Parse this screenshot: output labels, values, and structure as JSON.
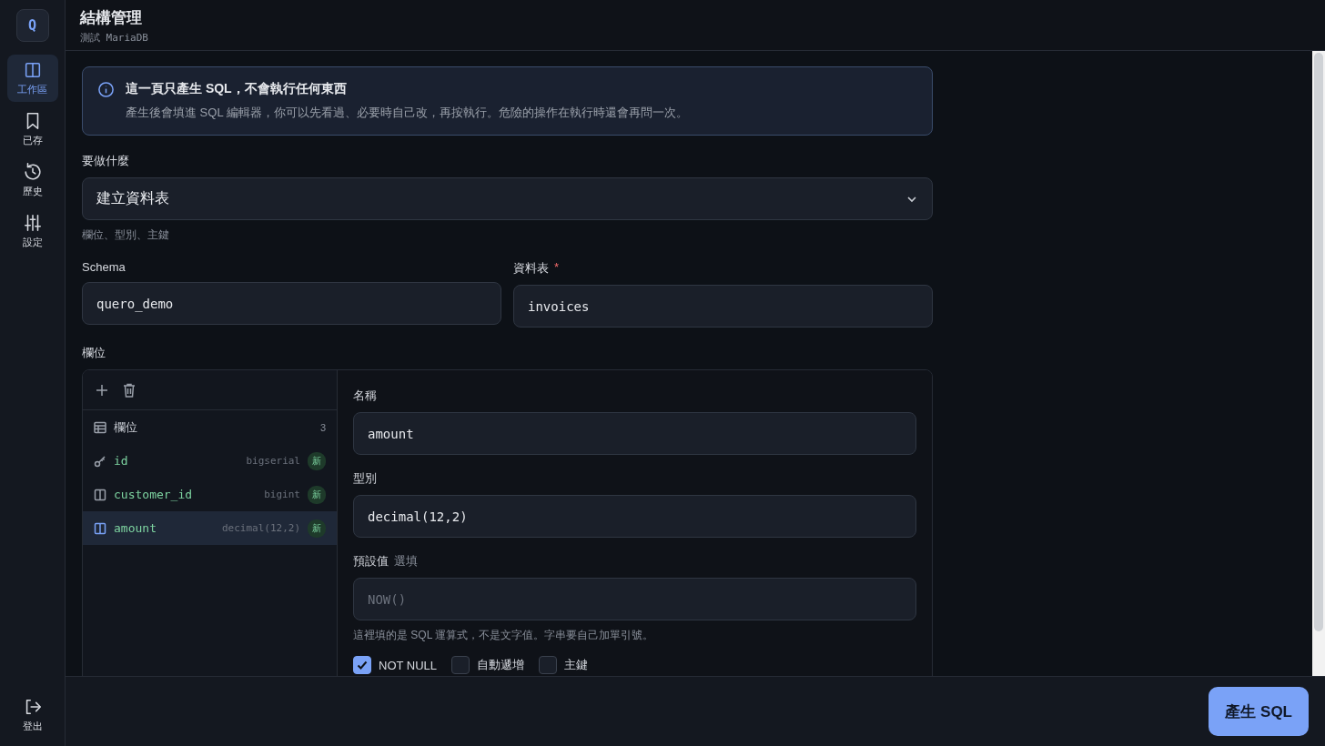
{
  "sidebar": {
    "logo": "Q",
    "items": [
      {
        "label": "工作區",
        "selected": true
      },
      {
        "label": "已存",
        "selected": false
      },
      {
        "label": "歷史",
        "selected": false
      },
      {
        "label": "設定",
        "selected": false
      }
    ],
    "logout": "登出"
  },
  "header": {
    "title": "結構管理",
    "subtitle": "測試 MariaDB"
  },
  "notice": {
    "title": "這一頁只產生 SQL，不會執行任何東西",
    "body": "產生後會填進 SQL 編輯器，你可以先看過、必要時自己改，再按執行。危險的操作在執行時還會再問一次。"
  },
  "action": {
    "label": "要做什麼",
    "value": "建立資料表",
    "hint": "欄位、型別、主鍵"
  },
  "schema": {
    "label": "Schema",
    "value": "quero_demo"
  },
  "table": {
    "label": "資料表",
    "required": "*",
    "value": "invoices"
  },
  "columns": {
    "label": "欄位",
    "list_header": "欄位",
    "count": "3",
    "items": [
      {
        "kind": "key",
        "name": "id",
        "type": "bigserial",
        "badge": "新",
        "selected": false
      },
      {
        "kind": "column",
        "name": "customer_id",
        "type": "bigint",
        "badge": "新",
        "selected": false
      },
      {
        "kind": "column",
        "name": "amount",
        "type": "decimal(12,2)",
        "badge": "新",
        "selected": true
      }
    ],
    "editor": {
      "name_label": "名稱",
      "name_value": "amount",
      "type_label": "型別",
      "type_value": "decimal(12,2)",
      "default_label": "預設值",
      "default_optional": "選填",
      "default_placeholder": "NOW()",
      "default_hint": "這裡填的是 SQL 運算式，不是文字值。字串要自己加單引號。",
      "checkboxes": [
        {
          "label": "NOT NULL",
          "checked": true
        },
        {
          "label": "自動遞增",
          "checked": false
        },
        {
          "label": "主鍵",
          "checked": false
        }
      ]
    }
  },
  "footer": {
    "button": "產生 SQL"
  }
}
